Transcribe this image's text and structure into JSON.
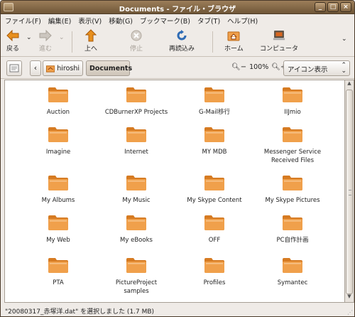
{
  "window": {
    "title": "Documents - ファイル・ブラウザ"
  },
  "titlebar_buttons": [
    "_",
    "□",
    "×"
  ],
  "menu": [
    "ファイル(F)",
    "編集(E)",
    "表示(V)",
    "移動(G)",
    "ブックマーク(B)",
    "タブ(T)",
    "ヘルプ(H)"
  ],
  "toolbar": {
    "back": "戻る",
    "forward": "進む",
    "up": "上へ",
    "stop": "停止",
    "reload": "再読込み",
    "home": "ホーム",
    "computer": "コンピュータ"
  },
  "location": {
    "crumbs": [
      "hiroshi",
      "Documents"
    ],
    "zoom": "100%",
    "view": "アイコン表示"
  },
  "files": [
    "Auction",
    "CDBurnerXP Projects",
    "G-Mail移行",
    "IIJmio",
    "Imagine",
    "Internet",
    "MY MDB",
    "Messenger Service\nReceived Files",
    "My Albums",
    "My Music",
    "My Skype Content",
    "My Skype Pictures",
    "My Web",
    "My eBooks",
    "OFF",
    "PC自作計画",
    "PTA",
    "PictureProject\nsamples",
    "Profiles",
    "Symantec"
  ],
  "status": "\"20080317_赤塚洋.dat\" を選択しました (1.7 MB)",
  "colors": {
    "folder": "#f0a04b",
    "folderDark": "#d67b22",
    "titlebar": "#8a6e4c"
  }
}
